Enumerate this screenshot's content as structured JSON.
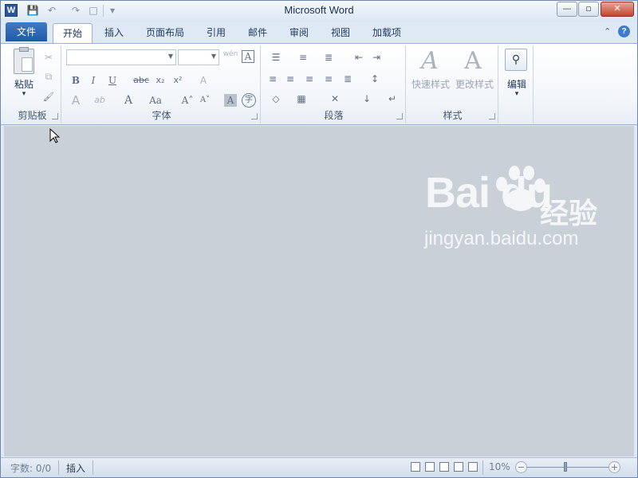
{
  "window": {
    "title": "Microsoft Word",
    "app_icon": "W",
    "controls": {
      "minimize": "—",
      "restore": "▫",
      "close": "✕"
    }
  },
  "quick_access": {
    "save": "💾",
    "undo": "↶",
    "redo": "↷",
    "new": "□",
    "customize": "▾"
  },
  "tabs": [
    {
      "label": "文件"
    },
    {
      "label": "开始"
    },
    {
      "label": "插入"
    },
    {
      "label": "页面布局"
    },
    {
      "label": "引用"
    },
    {
      "label": "邮件"
    },
    {
      "label": "审阅"
    },
    {
      "label": "视图"
    },
    {
      "label": "加载项"
    }
  ],
  "ribbon": {
    "clipboard": {
      "label": "剪贴板",
      "paste": "粘贴",
      "paste_arrow": "▾",
      "cut": "✂",
      "copy": "⧉",
      "format_painter": "🖌"
    },
    "font": {
      "label": "字体",
      "font_name": "",
      "font_size": "",
      "phonetic": "wén",
      "border_char": "A",
      "bold": "B",
      "italic": "I",
      "underline": "U",
      "strike": "abc",
      "subscript": "x₂",
      "superscript": "x²",
      "clear": "A",
      "effects": "A",
      "highlight": "ab",
      "font_color": "A",
      "change_case": "Aa",
      "grow": "A˄",
      "shrink": "A˅",
      "shading_char": "A",
      "enclose": "字"
    },
    "paragraph": {
      "label": "段落",
      "bullets": "☰",
      "numbering": "≡",
      "multilevel": "≣",
      "decrease_indent": "⇤",
      "increase_indent": "⇥",
      "align_left": "≡",
      "center": "≡",
      "align_right": "≡",
      "justify": "≡",
      "distributed": "≣",
      "line_spacing": "↕",
      "shading": "◇",
      "borders": "▦",
      "chinese_layout": "✕",
      "sort": "↓",
      "show_marks": "↵"
    },
    "styles": {
      "label": "样式",
      "quick": "快速样式",
      "change": "更改样式"
    },
    "editing": {
      "label": "编辑",
      "arrow": "▾"
    }
  },
  "watermark": {
    "logo": "Bai du",
    "logo_cn": "经验",
    "url": "jingyan.baidu.com"
  },
  "status": {
    "word_count": "字数: 0/0",
    "mode": "插入",
    "zoom": "10%",
    "zoom_out": "−",
    "zoom_in": "+"
  }
}
